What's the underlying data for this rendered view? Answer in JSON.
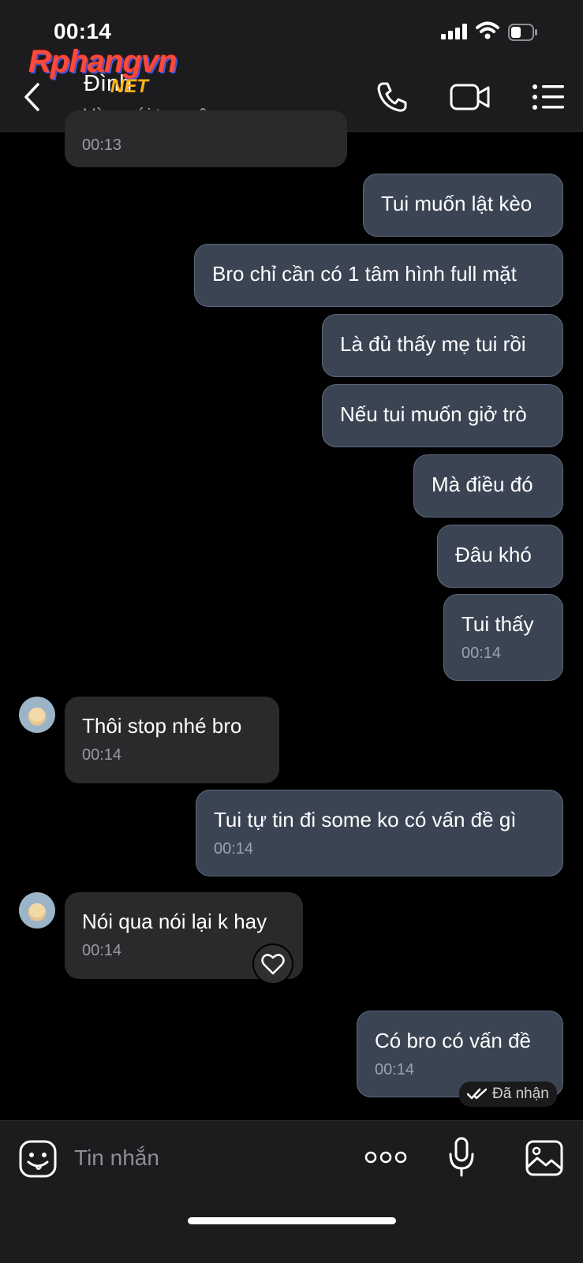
{
  "status_bar": {
    "time": "00:14"
  },
  "watermark": {
    "brand": "Rphangvn",
    "suffix": "NET"
  },
  "header": {
    "contact_name": "Đình",
    "contact_status": "Vừa mới truy cập"
  },
  "messages": [
    {
      "direction": "in",
      "text": "",
      "time": "00:13"
    },
    {
      "direction": "out",
      "text": "Tui muốn lật kèo",
      "time": ""
    },
    {
      "direction": "out",
      "text": "Bro chỉ cần có 1 tâm hình full mặt",
      "time": ""
    },
    {
      "direction": "out",
      "text": "Là đủ thấy mẹ tui rồi",
      "time": ""
    },
    {
      "direction": "out",
      "text": "Nếu tui muốn giở trò",
      "time": ""
    },
    {
      "direction": "out",
      "text": "Mà điều đó",
      "time": ""
    },
    {
      "direction": "out",
      "text": "Đâu khó",
      "time": ""
    },
    {
      "direction": "out",
      "text": "Tui thấy",
      "time": "00:14"
    },
    {
      "direction": "in",
      "text": "Thôi stop nhé bro",
      "time": "00:14"
    },
    {
      "direction": "out",
      "text": "Tui tự tin đi some ko có vấn đề gì",
      "time": "00:14"
    },
    {
      "direction": "in",
      "text": "Nói qua nói lại k hay",
      "time": "00:14"
    },
    {
      "direction": "out",
      "text": "Có bro có vấn đề",
      "time": "00:14"
    }
  ],
  "receipt": {
    "label": "Đã nhận"
  },
  "composer": {
    "placeholder": "Tin nhắn"
  },
  "colors": {
    "header_bg": "#1c1c1e",
    "outgoing_bubble": "#3b4453",
    "incoming_bubble": "#2a2a2c",
    "background": "#000000"
  },
  "icons": [
    "back-icon",
    "phone-icon",
    "video-icon",
    "menu-icon",
    "heart-icon",
    "double-check-icon",
    "sticker-icon",
    "more-icon",
    "microphone-icon",
    "image-icon"
  ]
}
